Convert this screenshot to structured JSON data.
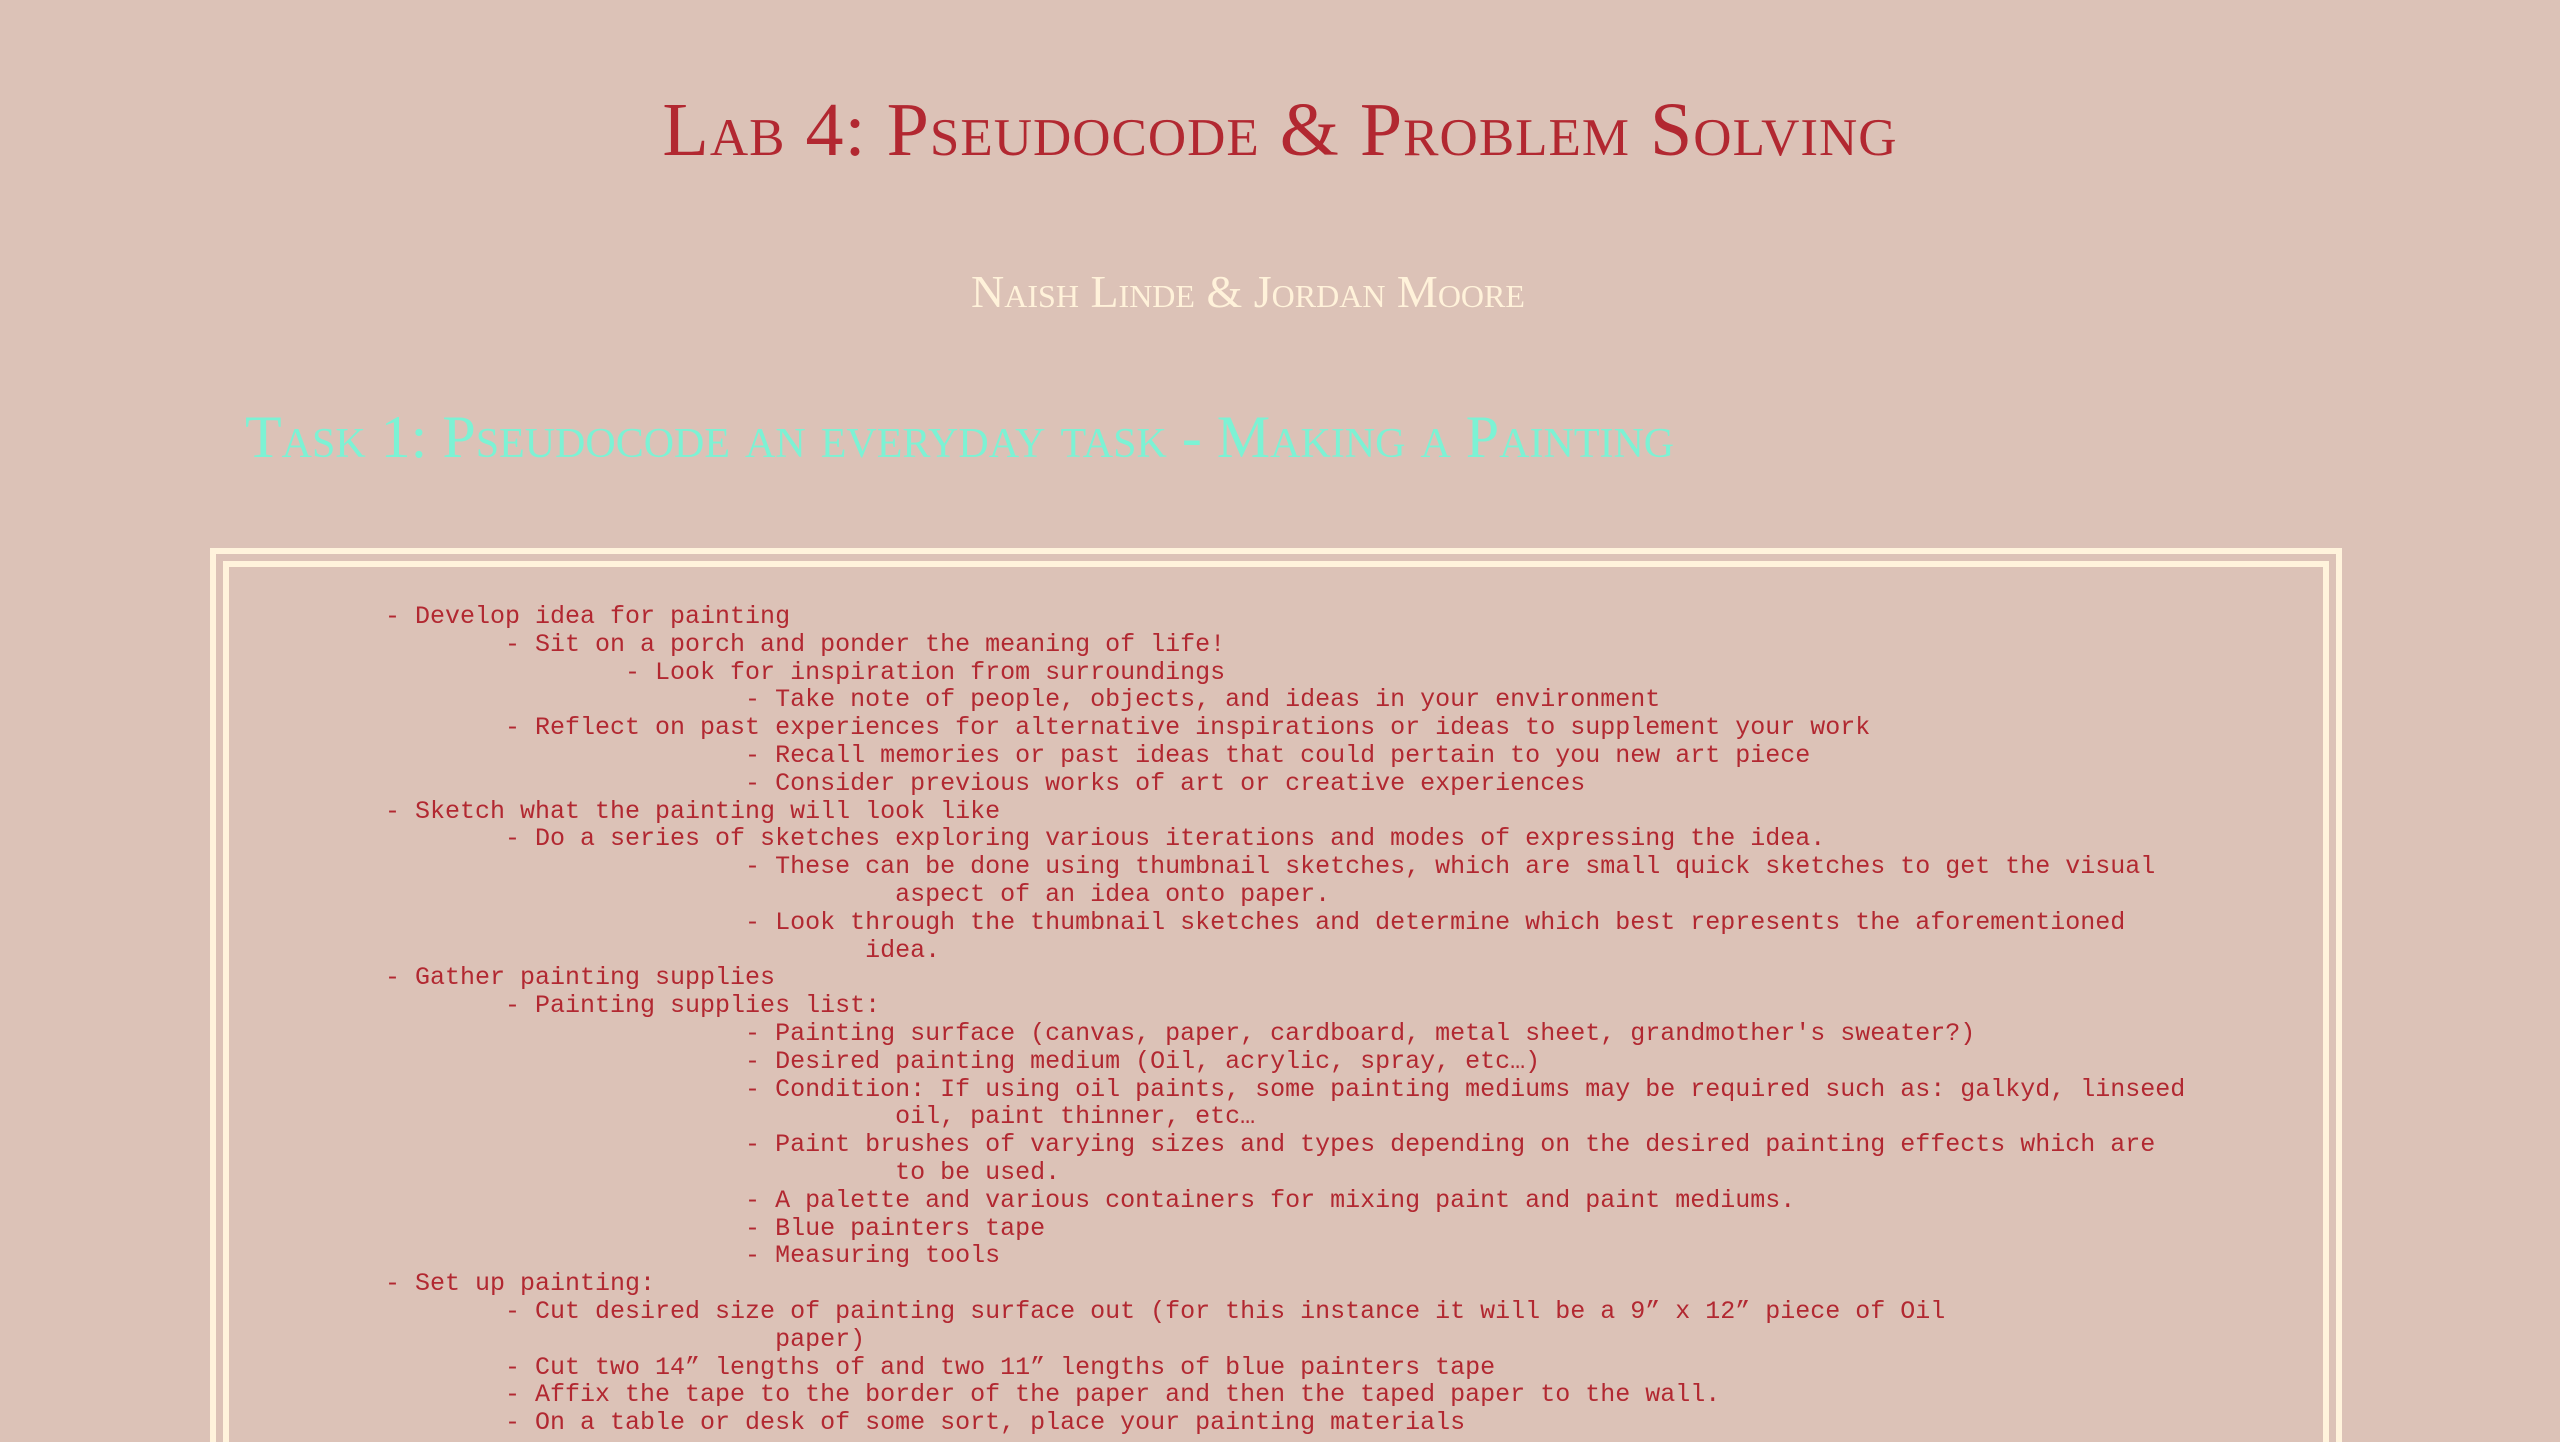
{
  "title": "Lab 4: Pseudocode & Problem Solving",
  "authors": "Naish Linde & Jordan Moore",
  "task_heading": "Task 1: Pseudocode an everyday task - Making a Painting",
  "code_lines": [
    "- Develop idea for painting",
    "        - Sit on a porch and ponder the meaning of life!",
    "                - Look for inspiration from surroundings",
    "                        - Take note of people, objects, and ideas in your environment",
    "        - Reflect on past experiences for alternative inspirations or ideas to supplement your work",
    "                        - Recall memories or past ideas that could pertain to you new art piece",
    "                        - Consider previous works of art or creative experiences",
    "- Sketch what the painting will look like",
    "        - Do a series of sketches exploring various iterations and modes of expressing the idea.",
    "                        - These can be done using thumbnail sketches, which are small quick sketches to get the visual",
    "                                  aspect of an idea onto paper.",
    "                        - Look through the thumbnail sketches and determine which best represents the aforementioned",
    "                                idea.",
    "- Gather painting supplies",
    "        - Painting supplies list:",
    "                        - Painting surface (canvas, paper, cardboard, metal sheet, grandmother's sweater?)",
    "                        - Desired painting medium (Oil, acrylic, spray, etc…)",
    "                        - Condition: If using oil paints, some painting mediums may be required such as: galkyd, linseed",
    "                                  oil, paint thinner, etc…",
    "                        - Paint brushes of varying sizes and types depending on the desired painting effects which are",
    "                                  to be used.",
    "                        - A palette and various containers for mixing paint and paint mediums.",
    "                        - Blue painters tape",
    "                        - Measuring tools",
    "- Set up painting:",
    "        - Cut desired size of painting surface out (for this instance it will be a 9” x 12” piece of Oil",
    "                          paper)",
    "        - Cut two 14” lengths of and two 11” lengths of blue painters tape",
    "        - Affix the tape to the border of the paper and then the taped paper to the wall.",
    "        - On a table or desk of some sort, place your painting materials"
  ]
}
